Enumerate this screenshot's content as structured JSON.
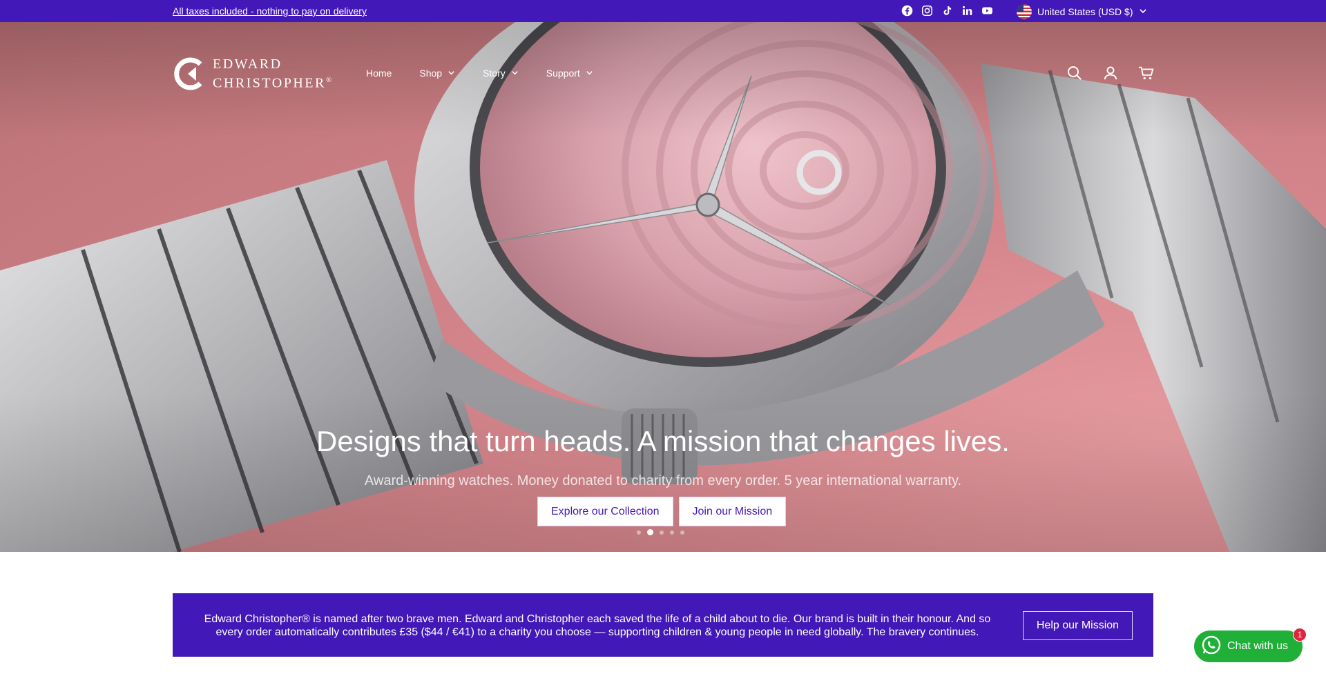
{
  "announcement": {
    "text": "All taxes included - nothing to pay on delivery",
    "socials": [
      "facebook-icon",
      "instagram-icon",
      "tiktok-icon",
      "linkedin-icon",
      "youtube-icon"
    ],
    "country": "United States (USD $)"
  },
  "header": {
    "logo_line1": "EDWARD",
    "logo_line2": "CHRISTOPHER",
    "logo_mark": "®",
    "nav": [
      {
        "label": "Home",
        "dropdown": false
      },
      {
        "label": "Shop",
        "dropdown": true
      },
      {
        "label": "Story",
        "dropdown": true
      },
      {
        "label": "Support",
        "dropdown": true
      }
    ],
    "icons": [
      "search-icon",
      "account-icon",
      "cart-icon"
    ]
  },
  "hero": {
    "title": "Designs that turn heads. A mission that changes lives.",
    "subtitle": "Award-winning watches. Money donated to charity from every order. 5 year international warranty.",
    "primary_button": "Explore our Collection",
    "secondary_button": "Join our Mission",
    "slides_total": 5,
    "active_slide": 2
  },
  "mission": {
    "text": "Edward Christopher® is named after two brave men. Edward and Christopher each saved the life of a child about to die. Our brand is built in their honour. And so every order automatically contributes £35 ($44 / €41) to a charity you choose — supporting children & young people in need globally. The bravery continues.",
    "button": "Help our Mission"
  },
  "chat": {
    "label": "Chat with us",
    "badge": "1"
  },
  "colors": {
    "brand_purple": "#4318b8",
    "chat_green": "#20b038",
    "hero_pink": "#d6878d"
  }
}
